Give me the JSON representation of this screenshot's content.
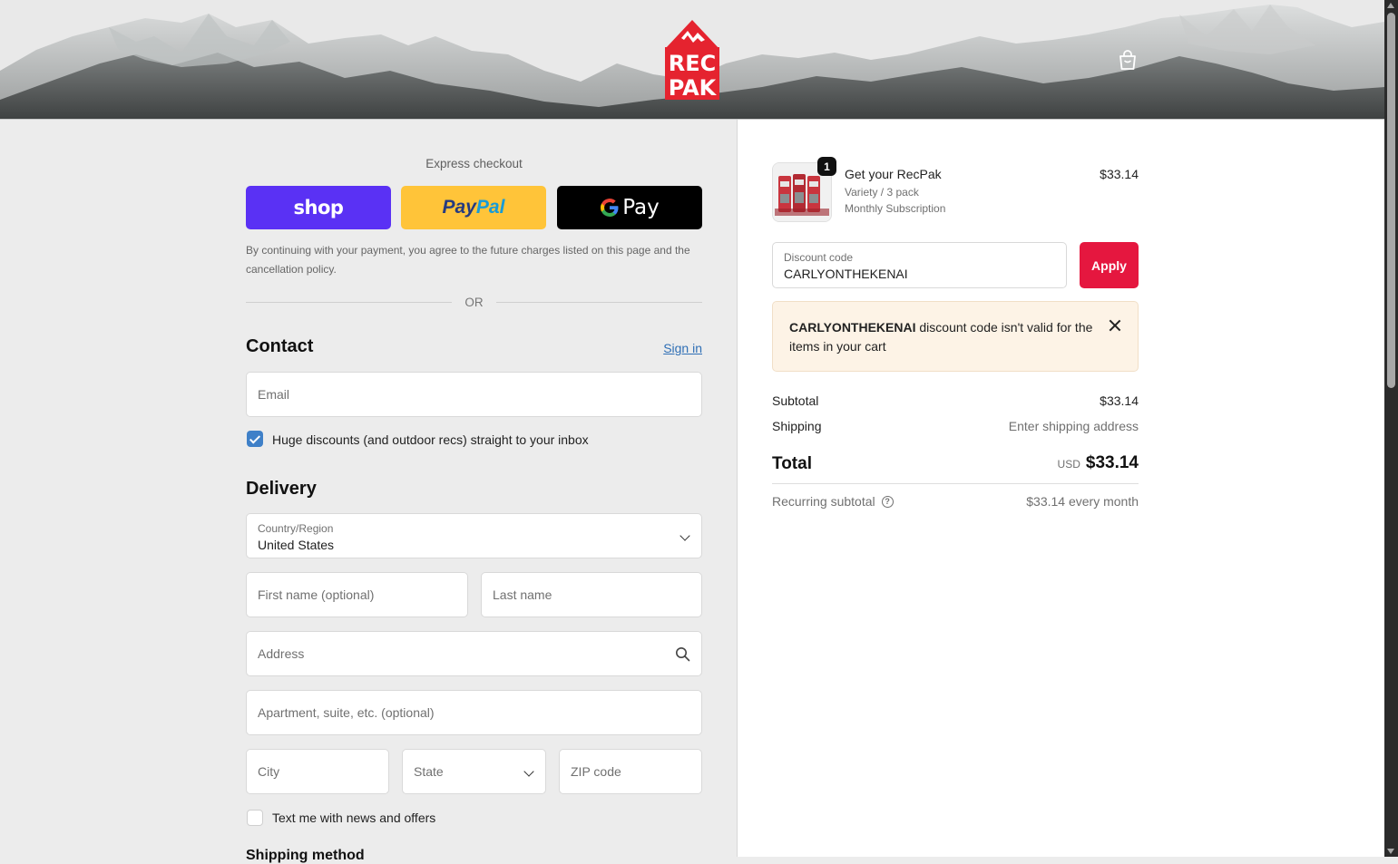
{
  "header": {
    "logo_line1": "REC",
    "logo_line2": "PAK",
    "cart_icon": "shopping-bag-icon"
  },
  "express": {
    "title": "Express checkout",
    "shop_label": "shop",
    "paypal_label_1": "Pay",
    "paypal_label_2": "Pal",
    "gpay_label": "Pay",
    "disclaimer": "By continuing with your payment, you agree to the future charges listed on this page and the cancellation policy.",
    "or": "OR"
  },
  "contact": {
    "heading": "Contact",
    "sign_in": "Sign in",
    "email_placeholder": "Email",
    "newsletter_label": "Huge discounts (and outdoor recs) straight to your inbox",
    "newsletter_checked": true
  },
  "delivery": {
    "heading": "Delivery",
    "country_label": "Country/Region",
    "country_value": "United States",
    "first_name_placeholder": "First name (optional)",
    "last_name_placeholder": "Last name",
    "address_placeholder": "Address",
    "apartment_placeholder": "Apartment, suite, etc. (optional)",
    "city_placeholder": "City",
    "state_placeholder": "State",
    "zip_placeholder": "ZIP code",
    "sms_label": "Text me with news and offers",
    "sms_checked": false
  },
  "shipping_method": {
    "heading": "Shipping method"
  },
  "order": {
    "item": {
      "quantity": "1",
      "name": "Get your RecPak",
      "variant": "Variety / 3 pack",
      "subscription": "Monthly Subscription",
      "price": "$33.14"
    },
    "discount": {
      "label": "Discount code",
      "value": "CARLYONTHEKENAI",
      "apply": "Apply"
    },
    "alert": {
      "code": "CARLYONTHEKENAI",
      "message": " discount code isn't valid for the items in your cart"
    },
    "subtotal_label": "Subtotal",
    "subtotal_value": "$33.14",
    "shipping_label": "Shipping",
    "shipping_value": "Enter shipping address",
    "total_label": "Total",
    "total_currency": "USD",
    "total_value": "$33.14",
    "recurring_label": "Recurring subtotal",
    "recurring_value": "$33.14 every month"
  },
  "colors": {
    "shop": "#5a31f4",
    "paypal": "#ffc439",
    "gpay": "#000000",
    "apply": "#e5173f",
    "link": "#2f6fb5",
    "checkbox": "#3f80c8",
    "logo_red": "#e5232f"
  }
}
